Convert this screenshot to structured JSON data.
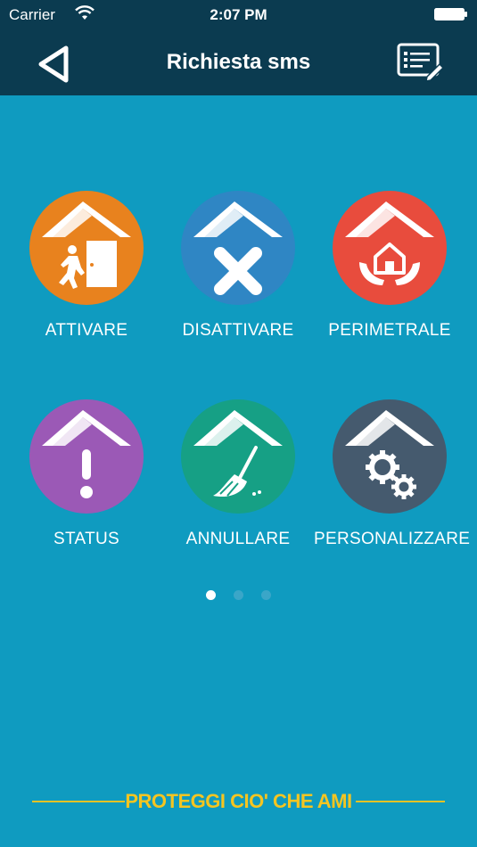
{
  "status_bar": {
    "carrier": "Carrier",
    "time": "2:07 PM"
  },
  "nav": {
    "title": "Richiesta sms",
    "back_icon": "back-triangle-icon",
    "right_icon": "form-edit-icon"
  },
  "actions": [
    {
      "label": "ATTIVARE",
      "color": "#e8821e",
      "icon": "exit-door-icon"
    },
    {
      "label": "DISATTIVARE",
      "color": "#2f86c4",
      "icon": "x-cross-icon"
    },
    {
      "label": "PERIMETRALE",
      "color": "#e84c3d",
      "icon": "house-hands-icon"
    },
    {
      "label": "STATUS",
      "color": "#9b59b6",
      "icon": "exclamation-icon"
    },
    {
      "label": "ANNULLARE",
      "color": "#16a085",
      "icon": "broom-icon"
    },
    {
      "label": "PERSONALIZZARE",
      "color": "#455a6e",
      "icon": "gears-icon"
    }
  ],
  "pager": {
    "pages": 3,
    "current": 1
  },
  "footer": {
    "slogan": "PROTEGGI CIO' CHE AMI"
  },
  "colors": {
    "header": "#0b3b50",
    "background": "#0f9bc0",
    "slogan": "#f4c521"
  }
}
